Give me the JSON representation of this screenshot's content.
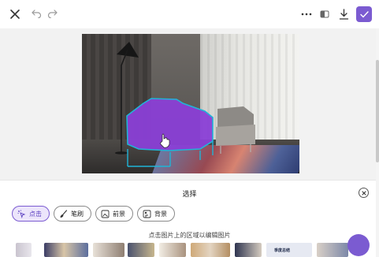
{
  "toolbar": {
    "icons": [
      "close-icon",
      "undo-icon",
      "redo-icon",
      "more-icon",
      "compare-icon",
      "download-icon",
      "check-icon"
    ],
    "accent_color": "#7b5bd1"
  },
  "canvas": {
    "image_subject": "armchair",
    "selection_color": "#8a3fd6",
    "outline_color": "#1fb5d8"
  },
  "panel": {
    "title": "选择",
    "modes": [
      {
        "label": "点击",
        "icon": "tap-select-icon",
        "active": true
      },
      {
        "label": "笔刷",
        "icon": "brush-icon",
        "active": false
      },
      {
        "label": "前景",
        "icon": "foreground-icon",
        "active": false
      },
      {
        "label": "背景",
        "icon": "background-icon",
        "active": false
      }
    ],
    "hint": "点击图片上的区域以编辑图片"
  },
  "strip": {
    "thumb_label": "季度总结"
  }
}
